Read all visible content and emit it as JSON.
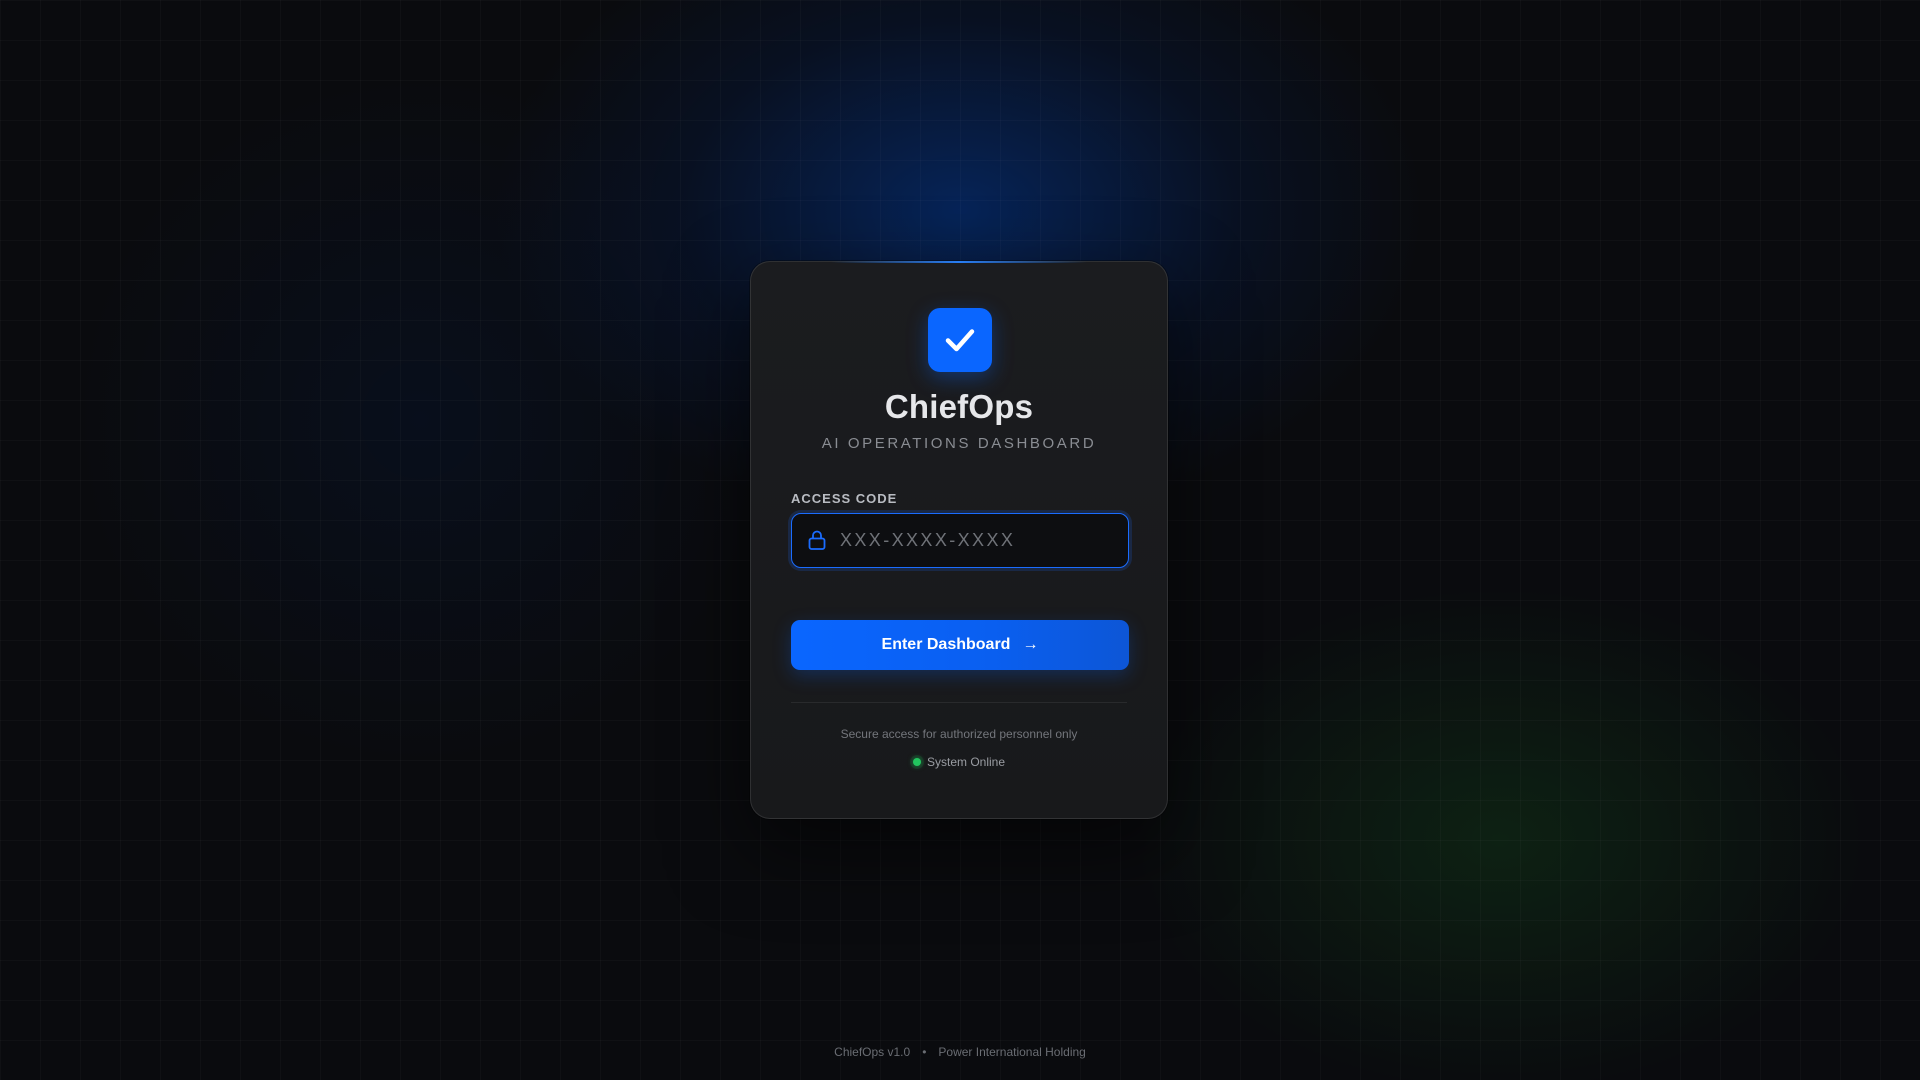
{
  "brand": {
    "title": "ChiefOps",
    "subtitle": "AI OPERATIONS DASHBOARD",
    "logo_icon": "checkmark-icon",
    "accent_color": "#0a66ff"
  },
  "login": {
    "field_label": "ACCESS CODE",
    "code_placeholder": "XXX-XXXX-XXXX",
    "code_value": "",
    "lock_icon": "lock-icon",
    "submit_label": "Enter Dashboard",
    "submit_arrow": "→"
  },
  "info": {
    "secure_note": "Secure access for authorized personnel only",
    "status_text": "System Online",
    "status_color": "#22c55e"
  },
  "footer": {
    "version": "ChiefOps v1.0",
    "separator": "•",
    "company": "Power International Holding"
  }
}
